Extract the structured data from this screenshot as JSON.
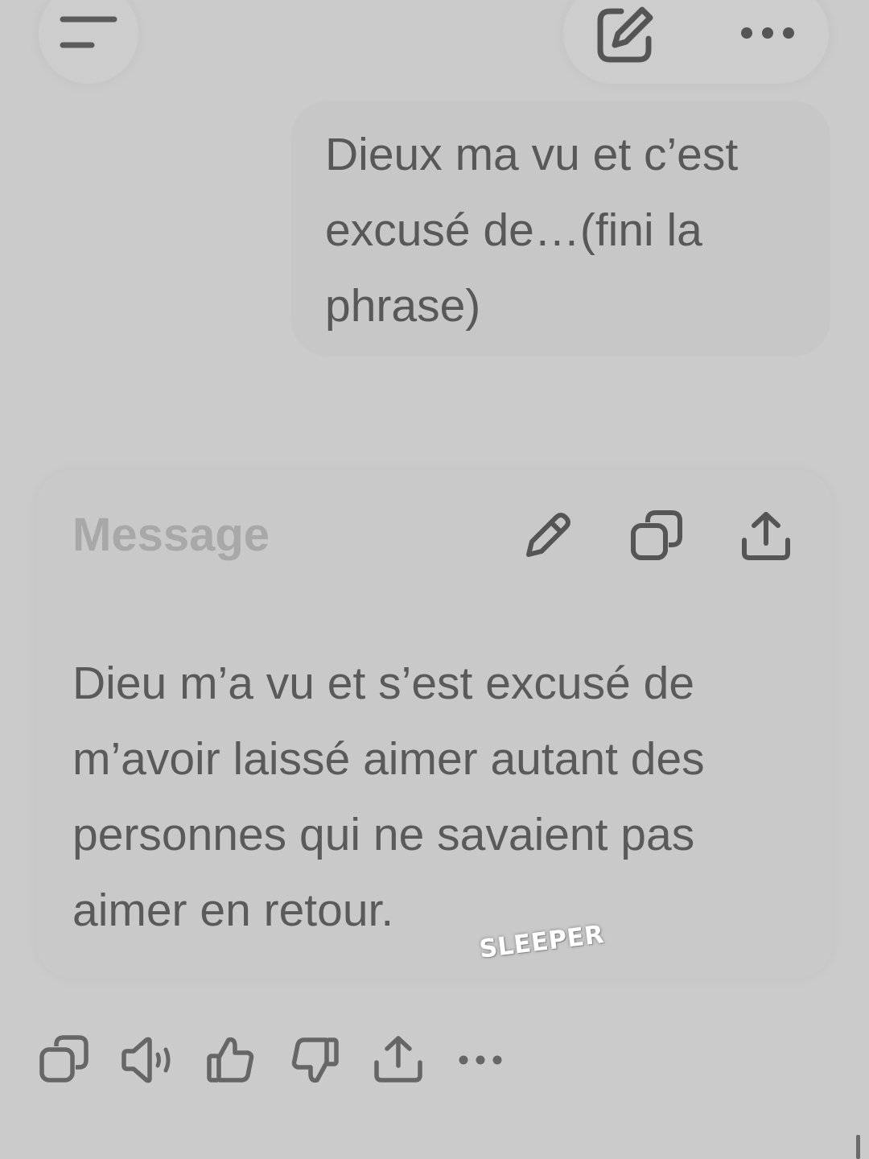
{
  "header": {
    "menu_icon": "menu-icon",
    "compose_icon": "new-chat-edit-icon",
    "more_icon": "more-horizontal-icon"
  },
  "user_message": {
    "text": "Dieux ma vu et c’est excusé de…(fini la phrase)"
  },
  "response": {
    "title": "Message",
    "edit_icon": "pencil-icon",
    "copy_icon": "copy-icon",
    "share_icon": "share-icon",
    "text": "Dieu m’a vu et s’est excusé de m’avoir laissé aimer autant des personnes qui ne savaient pas aimer en retour."
  },
  "watermark": {
    "text": "SLEEPER"
  },
  "actions": [
    {
      "icon": "copy-icon"
    },
    {
      "icon": "read-aloud-speaker-icon"
    },
    {
      "icon": "thumbs-up-icon"
    },
    {
      "icon": "thumbs-down-icon"
    },
    {
      "icon": "share-icon"
    },
    {
      "icon": "more-horizontal-icon"
    }
  ],
  "colors": {
    "background": "#cbcbcb",
    "text": "#585858",
    "title": "#a8a8a8"
  }
}
